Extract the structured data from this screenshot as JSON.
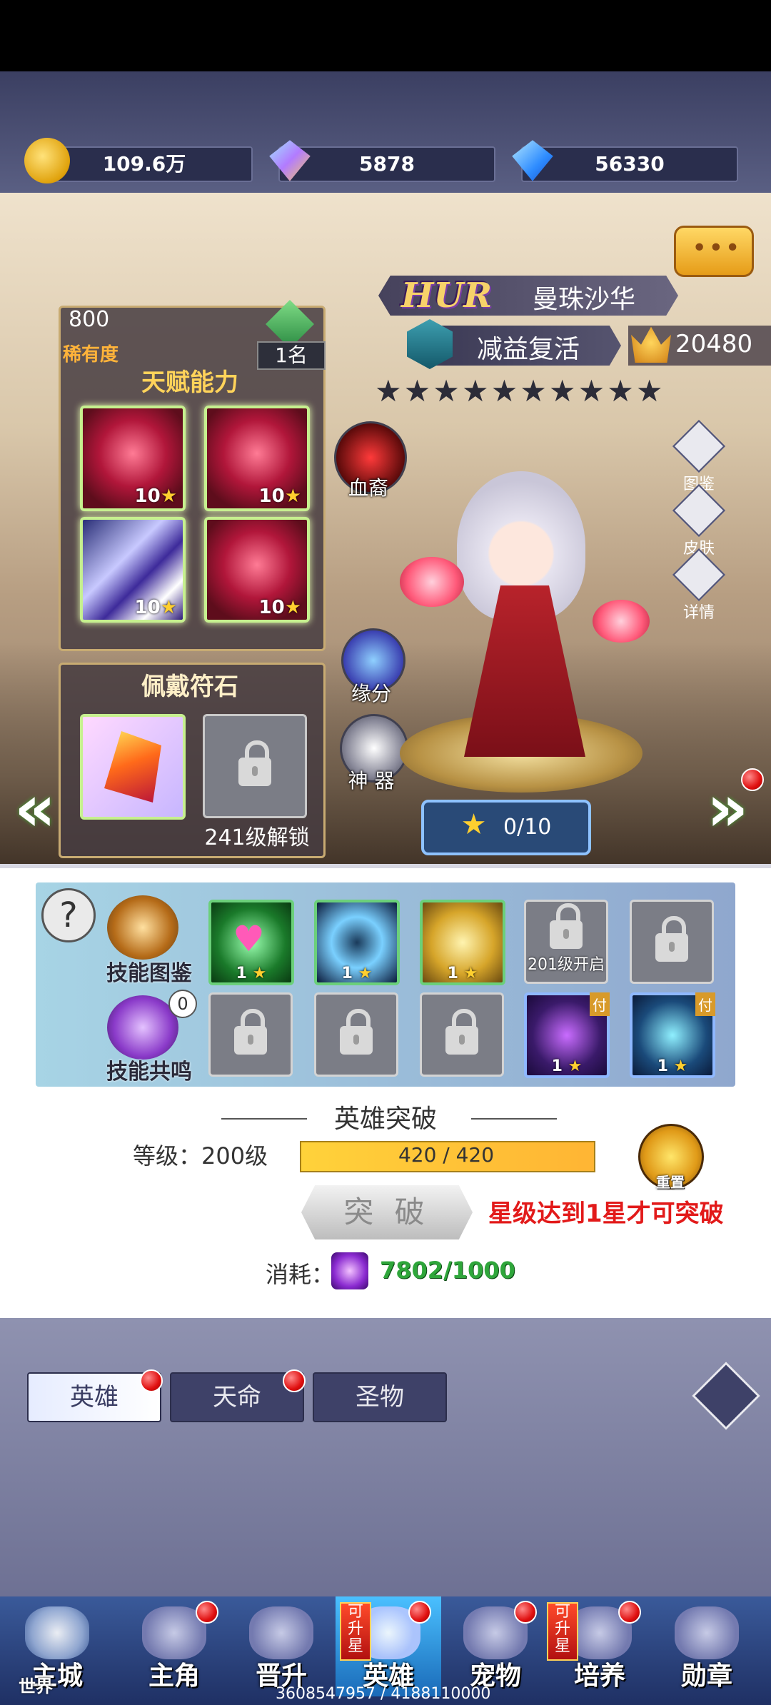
{
  "resources": [
    {
      "icon": "gold-coin-icon",
      "value": "109.6万"
    },
    {
      "icon": "rainbow-gem-icon",
      "value": "5878"
    },
    {
      "icon": "blue-diamond-icon",
      "value": "56330"
    }
  ],
  "hero": {
    "rarity_prefix": "HUR",
    "name": "曼珠沙华",
    "tag": "减益复活",
    "power": "20480",
    "stars": "★★★★★★★★★★"
  },
  "talent_panel": {
    "rarity_value": "800",
    "rarity_label": "稀有度",
    "rank": "1名",
    "title": "天赋能力",
    "talents": [
      {
        "level": "10",
        "icon": "red-flower-icon"
      },
      {
        "level": "10",
        "icon": "red-flower-icon"
      },
      {
        "level": "10",
        "icon": "swirl-icon"
      },
      {
        "level": "10",
        "icon": "red-flower-icon"
      }
    ]
  },
  "rune_panel": {
    "title": "佩戴符石",
    "unlock_text": "241级解锁"
  },
  "side_buttons": [
    "图鉴",
    "皮肤",
    "详情"
  ],
  "round_buttons": [
    "血裔",
    "缘分",
    "神 器"
  ],
  "star_progress": "0/10",
  "skills": {
    "library_label": "技能图鉴",
    "resonance_label": "技能共鸣",
    "resonance_count": "0",
    "row1": [
      {
        "state": "on",
        "level": "1",
        "icon": "heart-icon"
      },
      {
        "state": "on",
        "level": "1",
        "icon": "vortex-icon"
      },
      {
        "state": "on",
        "level": "1",
        "icon": "shield-icon"
      },
      {
        "state": "locked",
        "note": "201级开启"
      },
      {
        "state": "locked",
        "note": ""
      }
    ],
    "row2": [
      {
        "state": "locked",
        "note": ""
      },
      {
        "state": "locked",
        "note": ""
      },
      {
        "state": "locked",
        "note": ""
      },
      {
        "state": "alt",
        "level": "1",
        "icon": "shadow-figure-icon",
        "badge": "付"
      },
      {
        "state": "alt",
        "level": "1",
        "icon": "spirit-icon",
        "badge": "付"
      }
    ]
  },
  "breakthrough": {
    "title": "英雄突破",
    "level_label": "等级：200级",
    "progress_text": "420 / 420",
    "progress": 1.0,
    "reset_label": "重置",
    "button_label": "突 破",
    "warning": "星级达到1星才可突破",
    "cost_label": "消耗：",
    "cost_value": "7802/1000"
  },
  "tabs": [
    "英雄",
    "天命",
    "圣物"
  ],
  "nav": [
    {
      "label": "主城",
      "sub": "世界"
    },
    {
      "label": "主角"
    },
    {
      "label": "晋升"
    },
    {
      "label": "英雄",
      "badge": "可升星"
    },
    {
      "label": "宠物"
    },
    {
      "label": "培养",
      "badge": "可升星"
    },
    {
      "label": "勋章"
    }
  ],
  "footer": "3608547957 / 4188110000"
}
